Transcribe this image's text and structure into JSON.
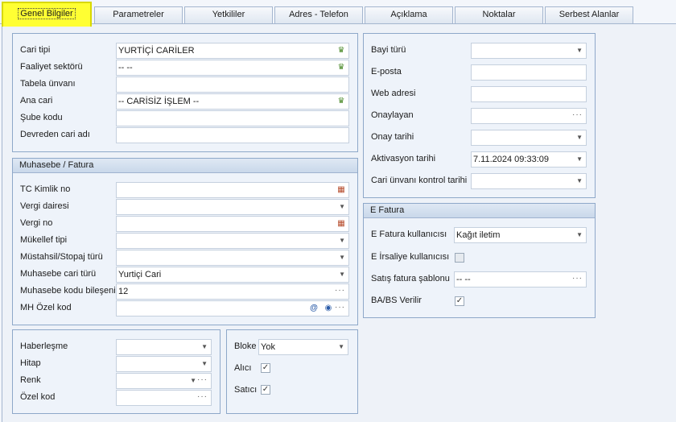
{
  "tabs": [
    "Genel Bilgiler",
    "Parametreler",
    "Yetkililer",
    "Adres - Telefon",
    "Açıklama",
    "Noktalar",
    "Serbest Alanlar"
  ],
  "general": {
    "cari_tipi": {
      "label": "Cari tipi",
      "value": "YURTİÇİ CARİLER"
    },
    "faaliyet": {
      "label": "Faaliyet sektörü",
      "value": "-- --"
    },
    "tabela": {
      "label": "Tabela ünvanı",
      "value": ""
    },
    "ana_cari": {
      "label": "Ana cari",
      "value": "-- CARİSİZ İŞLEM --"
    },
    "sube": {
      "label": "Şube kodu",
      "value": ""
    },
    "devreden": {
      "label": "Devreden cari adı",
      "value": ""
    }
  },
  "muhasebe": {
    "title": "Muhasebe / Fatura",
    "tc": {
      "label": "TC Kimlik no",
      "value": ""
    },
    "vergi_dairesi": {
      "label": "Vergi dairesi",
      "value": ""
    },
    "vergi_no": {
      "label": "Vergi no",
      "value": ""
    },
    "mukellef": {
      "label": "Mükellef tipi",
      "value": ""
    },
    "mustahsil": {
      "label": "Müstahsil/Stopaj türü",
      "value": ""
    },
    "cari_turu": {
      "label": "Muhasebe cari türü",
      "value": "Yurtiçi Cari"
    },
    "kod_bileseni": {
      "label": "Muhasebe kodu bileşeni",
      "value": "12"
    },
    "mh_ozel": {
      "label": "MH Özel kod",
      "value": ""
    }
  },
  "misc": {
    "haberlesme": {
      "label": "Haberleşme",
      "value": ""
    },
    "hitap": {
      "label": "Hitap",
      "value": ""
    },
    "renk": {
      "label": "Renk",
      "value": ""
    },
    "ozel_kod": {
      "label": "Özel kod",
      "value": ""
    }
  },
  "flags": {
    "bloke": {
      "label": "Bloke",
      "value": "Yok"
    },
    "alici": {
      "label": "Alıcı",
      "checked": true
    },
    "satici": {
      "label": "Satıcı",
      "checked": true
    }
  },
  "right": {
    "bayi": {
      "label": "Bayi türü",
      "value": ""
    },
    "eposta": {
      "label": "E-posta",
      "value": ""
    },
    "web": {
      "label": "Web adresi",
      "value": ""
    },
    "onaylayan": {
      "label": "Onaylayan",
      "value": ""
    },
    "onay_tarihi": {
      "label": "Onay tarihi",
      "value": ""
    },
    "aktivasyon": {
      "label": "Aktivasyon tarihi",
      "value": "7.11.2024 09:33:09"
    },
    "kontrol": {
      "label": "Cari ünvanı kontrol tarihi",
      "value": ""
    }
  },
  "efatura": {
    "title": "E Fatura",
    "kullanici": {
      "label": "E Fatura kullanıcısı",
      "value": "Kağıt iletim"
    },
    "irsaliye": {
      "label": "E İrsaliye kullanıcısı",
      "checked": false
    },
    "sablon": {
      "label": "Satış fatura şablonu",
      "value": "-- --"
    },
    "babs": {
      "label": "BA/BS Verilir",
      "checked": true
    }
  },
  "icons": {
    "lookup": "people-icon",
    "calendar": "calendar-icon",
    "dropdown": "chevron-down-icon",
    "ellipsis": "ellipsis-icon",
    "email": "at-icon",
    "view": "eye-icon"
  },
  "colors": {
    "active_tab": "#ffff33",
    "group_header": "#c9d8ea"
  }
}
